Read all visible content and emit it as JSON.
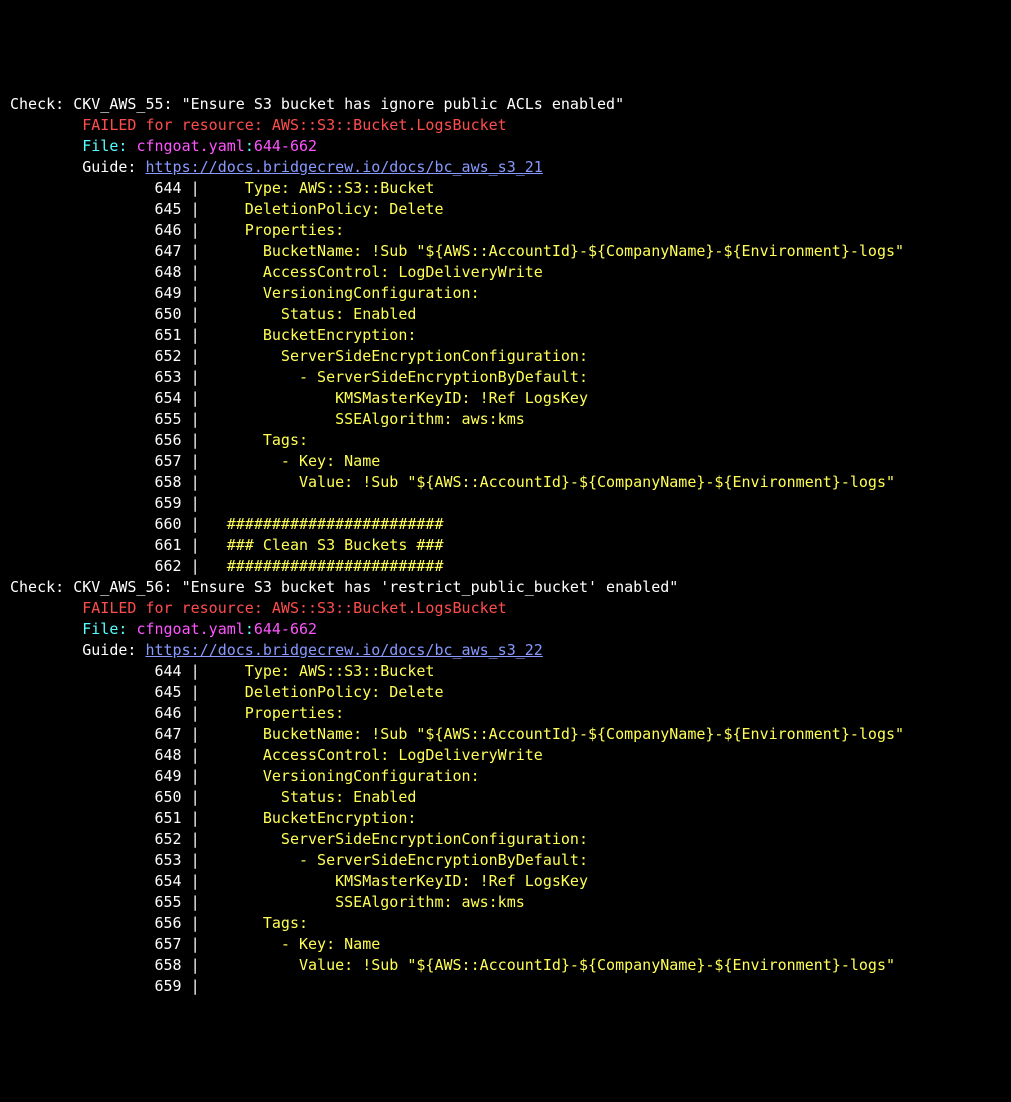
{
  "checks": [
    {
      "checkLabel": "Check: ",
      "checkId": "CKV_AWS_55",
      "checkSep": ": ",
      "checkTitle": "\"Ensure S3 bucket has ignore public ACLs enabled\"",
      "failedPrefix": "\tFAILED for resource: ",
      "failedResource": "AWS::S3::Bucket.LogsBucket",
      "fileLabel": "\tFile: ",
      "filePath": "cfngoat.yaml",
      "fileSep": ":",
      "fileRange": "644-662",
      "guideLabel": "\tGuide: ",
      "guideUrl": "https://docs.bridgecrew.io/docs/bc_aws_s3_21",
      "code": [
        {
          "ln": "644",
          "text": "    Type: AWS::S3::Bucket"
        },
        {
          "ln": "645",
          "text": "    DeletionPolicy: Delete"
        },
        {
          "ln": "646",
          "text": "    Properties:"
        },
        {
          "ln": "647",
          "text": "      BucketName: !Sub \"${AWS::AccountId}-${CompanyName}-${Environment}-logs\""
        },
        {
          "ln": "648",
          "text": "      AccessControl: LogDeliveryWrite"
        },
        {
          "ln": "649",
          "text": "      VersioningConfiguration:"
        },
        {
          "ln": "650",
          "text": "        Status: Enabled"
        },
        {
          "ln": "651",
          "text": "      BucketEncryption:"
        },
        {
          "ln": "652",
          "text": "        ServerSideEncryptionConfiguration:"
        },
        {
          "ln": "653",
          "text": "          - ServerSideEncryptionByDefault:"
        },
        {
          "ln": "654",
          "text": "              KMSMasterKeyID: !Ref LogsKey"
        },
        {
          "ln": "655",
          "text": "              SSEAlgorithm: aws:kms"
        },
        {
          "ln": "656",
          "text": "      Tags:"
        },
        {
          "ln": "657",
          "text": "        - Key: Name"
        },
        {
          "ln": "658",
          "text": "          Value: !Sub \"${AWS::AccountId}-${CompanyName}-${Environment}-logs\""
        },
        {
          "ln": "659",
          "text": ""
        },
        {
          "ln": "660",
          "text": "  ########################"
        },
        {
          "ln": "661",
          "text": "  ### Clean S3 Buckets ###"
        },
        {
          "ln": "662",
          "text": "  ########################"
        }
      ]
    },
    {
      "checkLabel": "Check: ",
      "checkId": "CKV_AWS_56",
      "checkSep": ": ",
      "checkTitle": "\"Ensure S3 bucket has 'restrict_public_bucket' enabled\"",
      "failedPrefix": "\tFAILED for resource: ",
      "failedResource": "AWS::S3::Bucket.LogsBucket",
      "fileLabel": "\tFile: ",
      "filePath": "cfngoat.yaml",
      "fileSep": ":",
      "fileRange": "644-662",
      "guideLabel": "\tGuide: ",
      "guideUrl": "https://docs.bridgecrew.io/docs/bc_aws_s3_22",
      "code": [
        {
          "ln": "644",
          "text": "    Type: AWS::S3::Bucket"
        },
        {
          "ln": "645",
          "text": "    DeletionPolicy: Delete"
        },
        {
          "ln": "646",
          "text": "    Properties:"
        },
        {
          "ln": "647",
          "text": "      BucketName: !Sub \"${AWS::AccountId}-${CompanyName}-${Environment}-logs\""
        },
        {
          "ln": "648",
          "text": "      AccessControl: LogDeliveryWrite"
        },
        {
          "ln": "649",
          "text": "      VersioningConfiguration:"
        },
        {
          "ln": "650",
          "text": "        Status: Enabled"
        },
        {
          "ln": "651",
          "text": "      BucketEncryption:"
        },
        {
          "ln": "652",
          "text": "        ServerSideEncryptionConfiguration:"
        },
        {
          "ln": "653",
          "text": "          - ServerSideEncryptionByDefault:"
        },
        {
          "ln": "654",
          "text": "              KMSMasterKeyID: !Ref LogsKey"
        },
        {
          "ln": "655",
          "text": "              SSEAlgorithm: aws:kms"
        },
        {
          "ln": "656",
          "text": "      Tags:"
        },
        {
          "ln": "657",
          "text": "        - Key: Name"
        },
        {
          "ln": "658",
          "text": "          Value: !Sub \"${AWS::AccountId}-${CompanyName}-${Environment}-logs\""
        },
        {
          "ln": "659",
          "text": ""
        }
      ]
    }
  ]
}
